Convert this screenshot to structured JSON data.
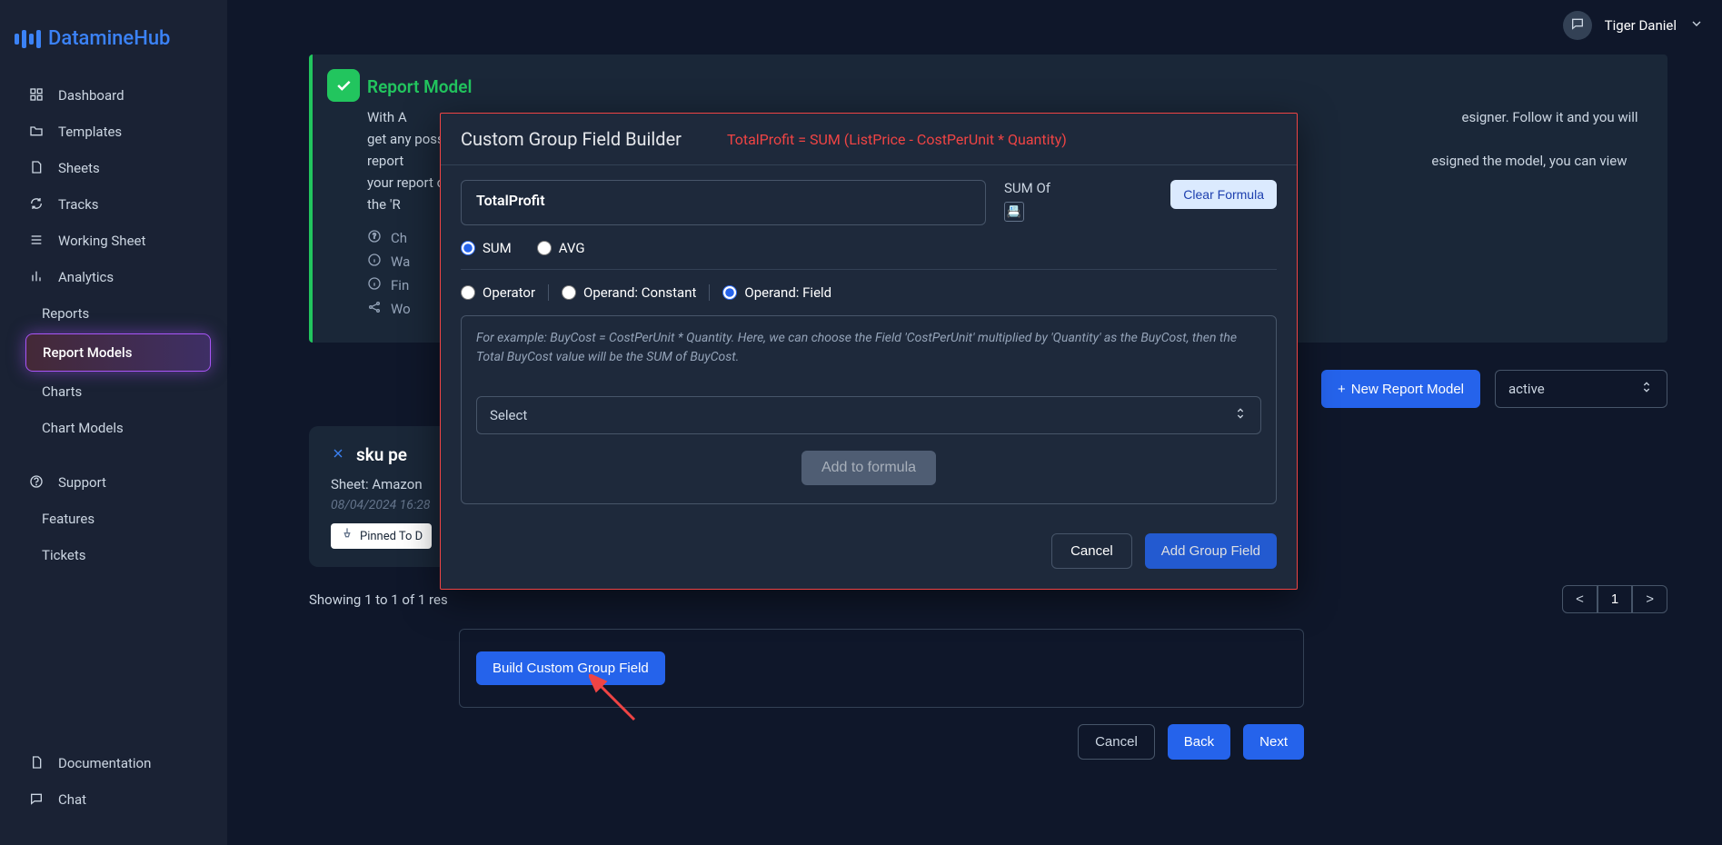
{
  "brand": {
    "name": "DatamineHub"
  },
  "topbar": {
    "user_name": "Tiger Daniel"
  },
  "sidebar": {
    "items": [
      {
        "label": "Dashboard",
        "icon": "grid"
      },
      {
        "label": "Templates",
        "icon": "folder"
      },
      {
        "label": "Sheets",
        "icon": "file"
      },
      {
        "label": "Tracks",
        "icon": "refresh"
      },
      {
        "label": "Working Sheet",
        "icon": "list"
      },
      {
        "label": "Analytics",
        "icon": "bars"
      }
    ],
    "sub_items": [
      {
        "label": "Reports"
      },
      {
        "label": "Report Models",
        "active": true
      },
      {
        "label": "Charts"
      },
      {
        "label": "Chart Models"
      }
    ],
    "support_label": "Support",
    "features_label": "Features",
    "tickets_label": "Tickets",
    "documentation_label": "Documentation",
    "chat_label": "Chat"
  },
  "banner": {
    "title": "Report Model",
    "text_prefix": "With A",
    "text_suffix": "esigner. Follow it and you will get any possible",
    "line2_prefix": "report",
    "line2_suffix": "esigned the model, you can view your report on",
    "line3_prefix": "the 'R",
    "rows": [
      {
        "label": "Ch"
      },
      {
        "label": "Wa"
      },
      {
        "label": "Fin"
      },
      {
        "label": "Wo"
      }
    ]
  },
  "toolbar": {
    "new_report_model": "New Report Model",
    "filter_selected": "active"
  },
  "card": {
    "title": "sku pe",
    "sheet_line": "Sheet: Amazon",
    "date": "08/04/2024 16:28",
    "badge": "Pinned To D"
  },
  "results_text": "Showing 1 to 1 of 1 res",
  "pagination": {
    "prev": "<",
    "page": "1",
    "next": ">"
  },
  "below": {
    "build_button": "Build Custom Group Field",
    "cancel": "Cancel",
    "back": "Back",
    "next": "Next"
  },
  "modal": {
    "title": "Custom Group Field Builder",
    "formula": "TotalProfit = SUM (ListPrice - CostPerUnit * Quantity)",
    "field_value": "TotalProfit",
    "sum_of_label": "SUM Of",
    "clear_formula": "Clear Formula",
    "agg_options": {
      "sum": "SUM",
      "avg": "AVG"
    },
    "operand_options": {
      "operator": "Operator",
      "constant": "Operand: Constant",
      "field": "Operand: Field"
    },
    "helper_text": "For example: BuyCost = CostPerUnit * Quantity. Here, we can choose the Field 'CostPerUnit' multiplied by 'Quantity' as the BuyCost, then the Total BuyCost value will be the SUM of BuyCost.",
    "select_placeholder": "Select",
    "add_to_formula": "Add to formula",
    "cancel": "Cancel",
    "add_group_field": "Add Group Field"
  }
}
